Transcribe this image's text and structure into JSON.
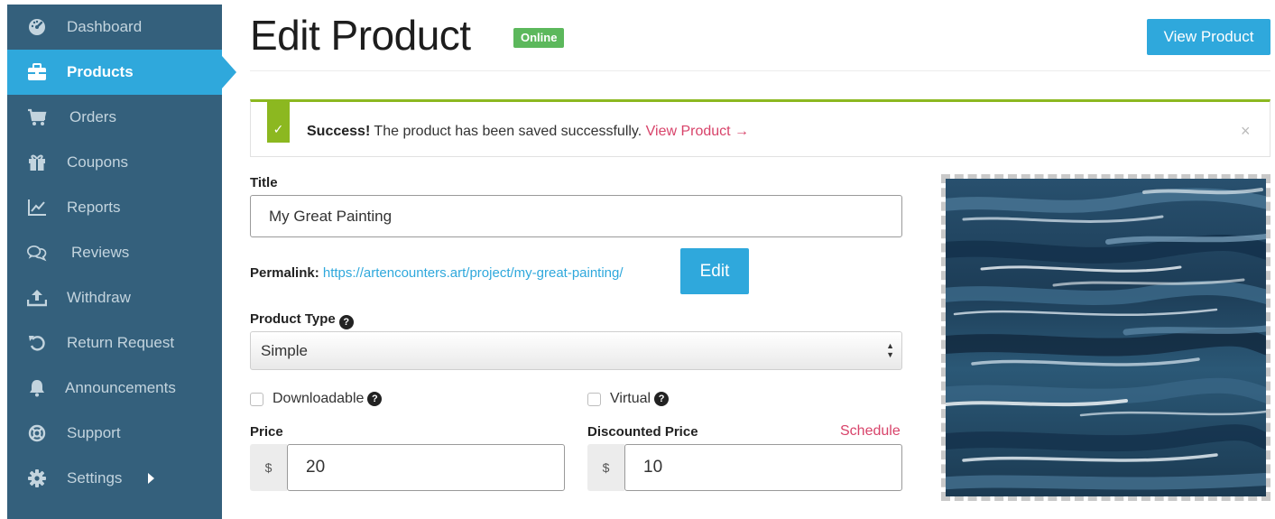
{
  "sidebar": {
    "items": [
      {
        "label": "Dashboard",
        "icon": "dashboard-icon"
      },
      {
        "label": "Products",
        "icon": "briefcase-icon",
        "active": true
      },
      {
        "label": "Orders",
        "icon": "cart-icon"
      },
      {
        "label": "Coupons",
        "icon": "gift-icon"
      },
      {
        "label": "Reports",
        "icon": "chart-icon"
      },
      {
        "label": "Reviews",
        "icon": "comments-icon"
      },
      {
        "label": "Withdraw",
        "icon": "upload-icon"
      },
      {
        "label": "Return Request",
        "icon": "undo-icon"
      },
      {
        "label": "Announcements",
        "icon": "bell-icon"
      },
      {
        "label": "Support",
        "icon": "lifebuoy-icon"
      },
      {
        "label": "Settings",
        "icon": "gear-icon"
      }
    ]
  },
  "header": {
    "title": "Edit Product",
    "status_badge": "Online",
    "view_button": "View Product"
  },
  "notice": {
    "check_glyph": "✓",
    "strong": "Success!",
    "message": " The product has been saved successfully. ",
    "link": "View Product →",
    "close_glyph": "×"
  },
  "form": {
    "title_label": "Title",
    "title_value": "My Great Painting",
    "permalink_label": "Permalink:",
    "permalink_url": "https://artencounters.art/project/my-great-painting/",
    "edit_button": "Edit",
    "product_type_label": "Product Type",
    "product_type_value": "Simple",
    "help_glyph": "?",
    "downloadable_label": "Downloadable",
    "virtual_label": "Virtual",
    "price_label": "Price",
    "price_currency": "$",
    "price_value": "20",
    "discount_label": "Discounted Price",
    "schedule_link": "Schedule",
    "discount_currency": "$",
    "discount_value": "10"
  },
  "colors": {
    "sidebar_bg": "#34607c",
    "accent": "#2fa8dc",
    "success": "#8cb820",
    "badge": "#5cb85c",
    "link_pink": "#d8436a"
  }
}
